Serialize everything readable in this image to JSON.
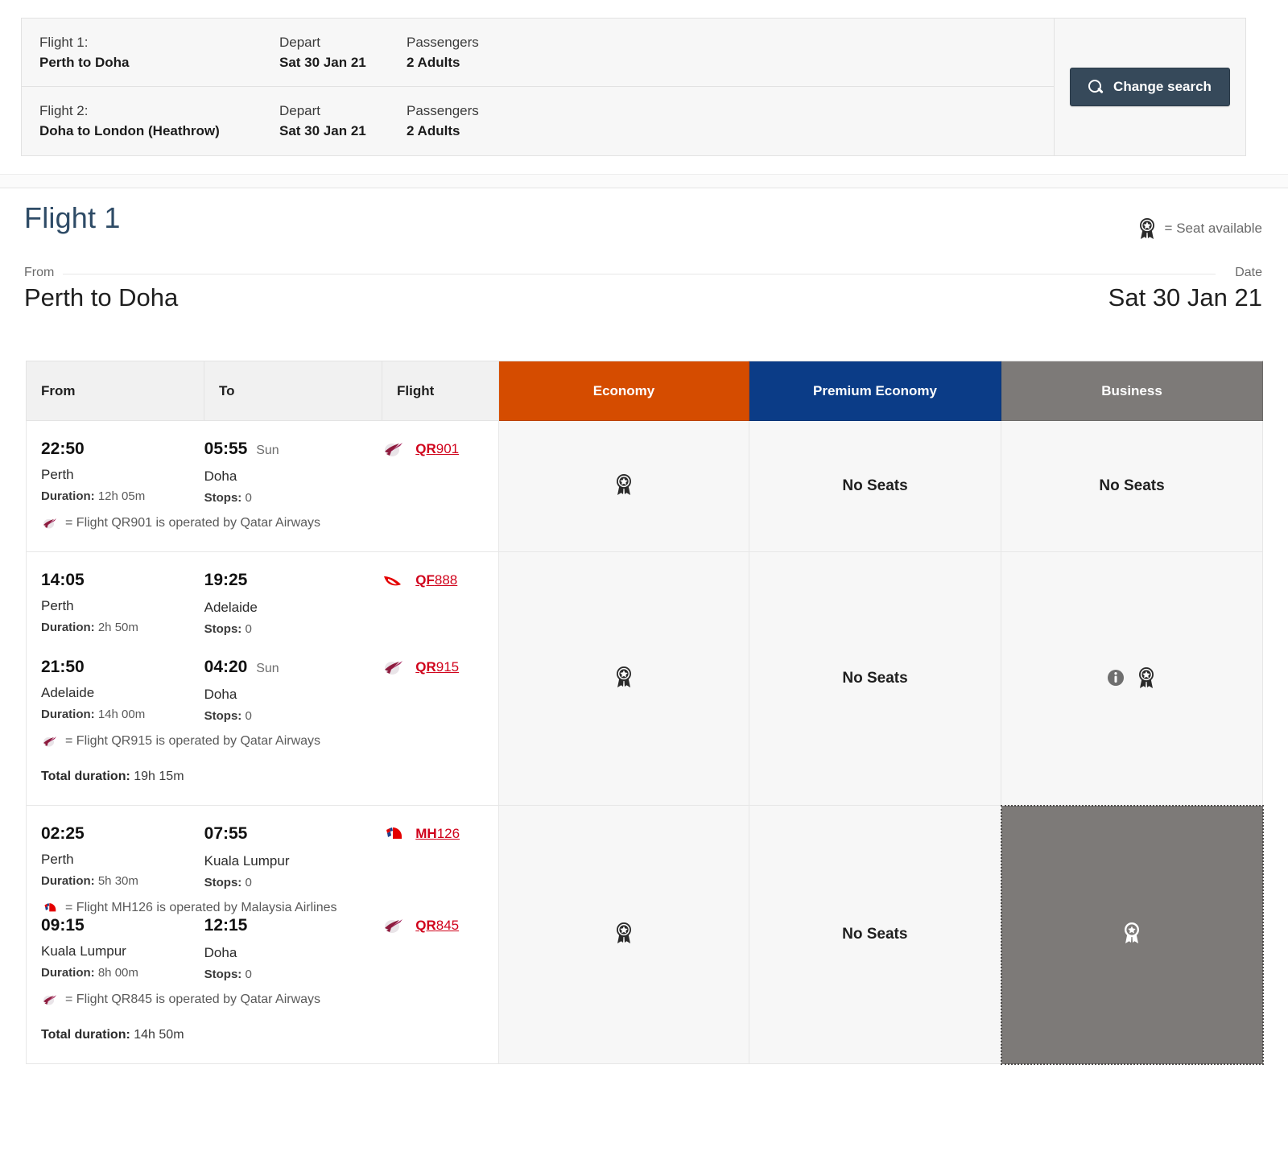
{
  "search_summary": {
    "legs": [
      {
        "label": "Flight 1:",
        "route": "Perth  to  Doha",
        "depart_label": "Depart",
        "depart_value": "Sat 30 Jan 21",
        "pax_label": "Passengers",
        "pax_value": "2 Adults"
      },
      {
        "label": "Flight 2:",
        "route": "Doha  to  London (Heathrow)",
        "depart_label": "Depart",
        "depart_value": "Sat 30 Jan 21",
        "pax_label": "Passengers",
        "pax_value": "2 Adults"
      }
    ],
    "change_search_label": "Change search"
  },
  "section": {
    "title": "Flight 1",
    "legend_text": "= Seat available",
    "from_label": "From",
    "from_value": "Perth to Doha",
    "date_label": "Date",
    "date_value": "Sat 30 Jan 21"
  },
  "table": {
    "headers": {
      "from": "From",
      "to": "To",
      "flight": "Flight",
      "economy": "Economy",
      "premium_economy": "Premium Economy",
      "business": "Business"
    },
    "header_colors": {
      "economy": "#d54c00",
      "premium_economy": "#0b3c87",
      "business": "#7d7a78"
    },
    "no_seats_label": "No Seats",
    "rows": [
      {
        "segments": [
          {
            "dep_time": "22:50",
            "dep_day": "",
            "arr_time": "05:55",
            "arr_day": "Sun",
            "dep_city": "Perth",
            "arr_city": "Doha",
            "duration_label": "Duration:",
            "duration": "12h 05m",
            "stops_label": "Stops:",
            "stops": "0",
            "airline": "qatar",
            "flight_prefix": "QR",
            "flight_number": "901",
            "operated_note": "= Flight QR901 is operated by Qatar Airways"
          }
        ],
        "total_duration_label": "",
        "total_duration": "",
        "economy": {
          "state": "available"
        },
        "premium_economy": {
          "state": "none"
        },
        "business": {
          "state": "none"
        }
      },
      {
        "segments": [
          {
            "dep_time": "14:05",
            "dep_day": "",
            "arr_time": "19:25",
            "arr_day": "",
            "dep_city": "Perth",
            "arr_city": "Adelaide",
            "duration_label": "Duration:",
            "duration": "2h 50m",
            "stops_label": "Stops:",
            "stops": "0",
            "airline": "qantas",
            "flight_prefix": "QF",
            "flight_number": "888",
            "operated_note": ""
          },
          {
            "dep_time": "21:50",
            "dep_day": "",
            "arr_time": "04:20",
            "arr_day": "Sun",
            "dep_city": "Adelaide",
            "arr_city": "Doha",
            "duration_label": "Duration:",
            "duration": "14h 00m",
            "stops_label": "Stops:",
            "stops": "0",
            "airline": "qatar",
            "flight_prefix": "QR",
            "flight_number": "915",
            "operated_note": "= Flight QR915 is operated by Qatar Airways"
          }
        ],
        "total_duration_label": "Total duration:",
        "total_duration": "19h 15m",
        "economy": {
          "state": "available"
        },
        "premium_economy": {
          "state": "none"
        },
        "business": {
          "state": "available-info"
        }
      },
      {
        "segments": [
          {
            "dep_time": "02:25",
            "dep_day": "",
            "arr_time": "07:55",
            "arr_day": "",
            "dep_city": "Perth",
            "arr_city": "Kuala Lumpur",
            "duration_label": "Duration:",
            "duration": "5h 30m",
            "stops_label": "Stops:",
            "stops": "0",
            "airline": "malaysia",
            "flight_prefix": "MH",
            "flight_number": "126",
            "operated_note": "= Flight MH126 is operated by Malaysia Airlines"
          },
          {
            "dep_time": "09:15",
            "dep_day": "",
            "arr_time": "12:15",
            "arr_day": "",
            "dep_city": "Kuala Lumpur",
            "arr_city": "Doha",
            "duration_label": "Duration:",
            "duration": "8h 00m",
            "stops_label": "Stops:",
            "stops": "0",
            "airline": "qatar",
            "flight_prefix": "QR",
            "flight_number": "845",
            "operated_note": "= Flight QR845 is operated by Qatar Airways"
          }
        ],
        "total_duration_label": "Total duration:",
        "total_duration": "14h 50m",
        "economy": {
          "state": "available"
        },
        "premium_economy": {
          "state": "none"
        },
        "business": {
          "state": "selected"
        }
      }
    ]
  },
  "icons": {
    "seat_available": "rosette-star-icon",
    "info": "info-circle-icon",
    "search": "search-icon"
  }
}
